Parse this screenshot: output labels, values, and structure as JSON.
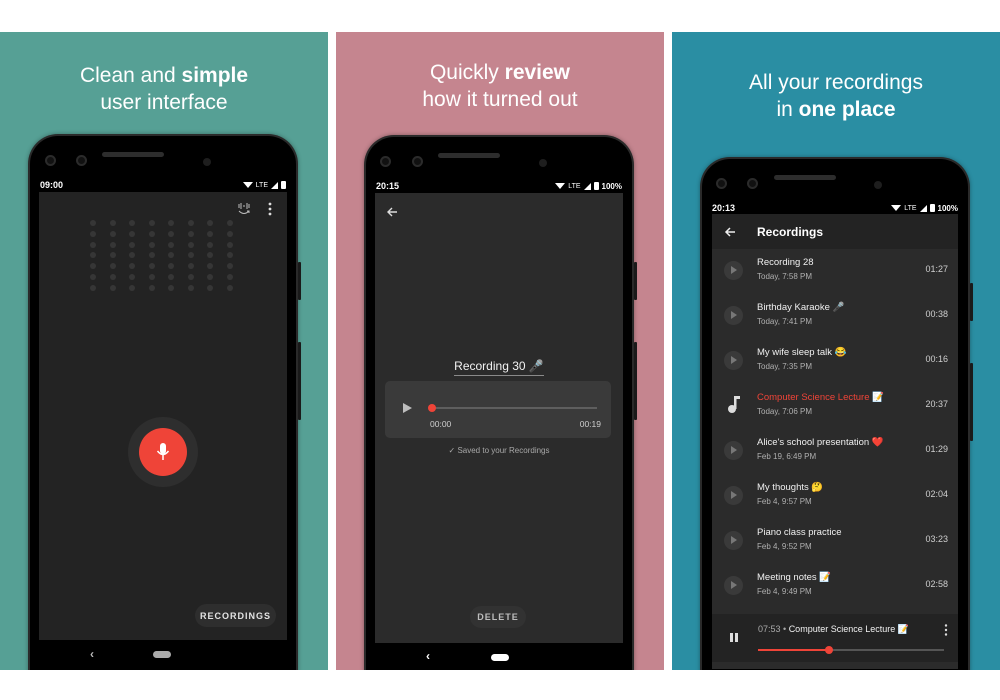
{
  "panels": [
    {
      "headline_line1_plain": "Clean and ",
      "headline_line1_bold": "simple",
      "headline_line2": "user interface",
      "background": "#56a095",
      "status_time": "09:00",
      "status_network": "LTE",
      "toolbar_icons": [
        "audio-format-icon",
        "more-vert-icon"
      ],
      "dot_grid": {
        "columns": 8,
        "rows": 7
      },
      "record_button_icon": "microphone-icon",
      "recordings_button": "RECORDINGS"
    },
    {
      "headline_line1_plain": "Quickly ",
      "headline_line1_bold": "review",
      "headline_line2": "how it turned out",
      "background": "#c5858f",
      "status_time": "20:15",
      "status_network": "LTE",
      "status_battery": "100%",
      "recording_title": "Recording 30 🎤",
      "player": {
        "position": "00:00",
        "duration": "00:19",
        "progress": 0
      },
      "saved_message": "Saved to your Recordings",
      "delete_button": "DELETE"
    },
    {
      "headline_line1_plain": "All your recordings",
      "headline_line2_plain": "in ",
      "headline_line2_bold": "one place",
      "background": "#2a8ea3",
      "status_time": "20:13",
      "status_network": "LTE",
      "status_battery": "100%",
      "appbar_title": "Recordings",
      "recordings": [
        {
          "title": "Recording 28",
          "date": "Today, 7:58 PM",
          "duration": "01:27",
          "playing": false
        },
        {
          "title": "Birthday Karaoke 🎤",
          "date": "Today, 7:41 PM",
          "duration": "00:38",
          "playing": false
        },
        {
          "title": "My wife sleep talk 😂",
          "date": "Today, 7:35 PM",
          "duration": "00:16",
          "playing": false
        },
        {
          "title": "Computer Science Lecture 📝",
          "date": "Today, 7:06 PM",
          "duration": "20:37",
          "playing": true
        },
        {
          "title": "Alice's school presentation ❤️",
          "date": "Feb 19, 6:49 PM",
          "duration": "01:29",
          "playing": false
        },
        {
          "title": "My thoughts 🤔",
          "date": "Feb 4, 9:57 PM",
          "duration": "02:04",
          "playing": false
        },
        {
          "title": "Piano class practice",
          "date": "Feb 4, 9:52 PM",
          "duration": "03:23",
          "playing": false
        },
        {
          "title": "Meeting notes 📝",
          "date": "Feb 4, 9:49 PM",
          "duration": "02:58",
          "playing": false
        }
      ],
      "mini_player": {
        "elapsed": "07:53",
        "separator": " • ",
        "title": "Computer Science Lecture 📝",
        "progress": 0.38
      }
    }
  ],
  "colors": {
    "accent_red": "#ef4438",
    "screen_dark": "#232323",
    "card_dark": "#3a3a3a"
  }
}
